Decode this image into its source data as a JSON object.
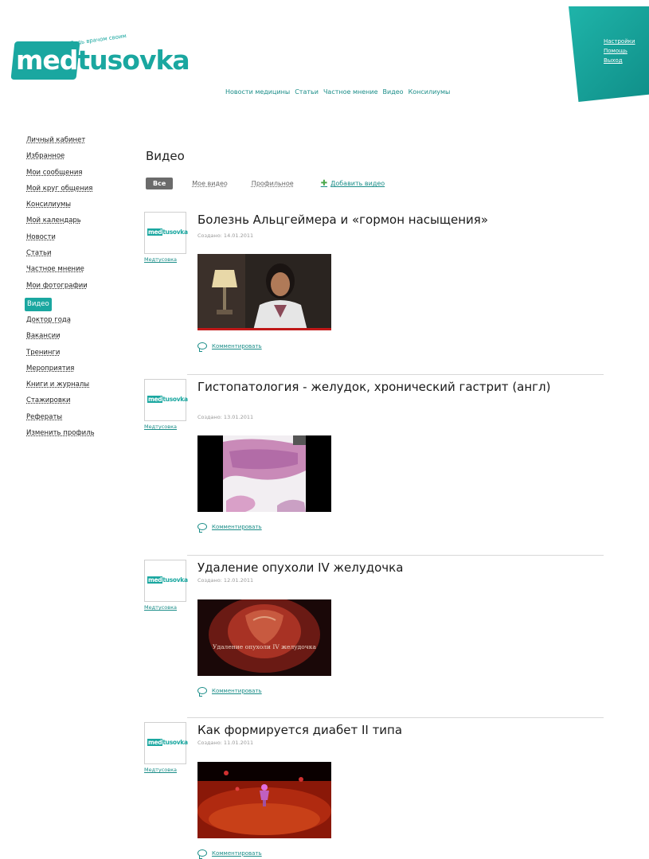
{
  "header": {
    "logo_prefix": "med",
    "logo_suffix": "tusovka",
    "tagline": "Будь врачом своим",
    "corner_links": [
      "Настройки",
      "Помощь",
      "Выход"
    ],
    "nav": [
      "Новости медицины",
      "Статьи",
      "Частное мнение",
      "Видео",
      "Консилиумы"
    ]
  },
  "sidebar": {
    "items": [
      "Личный кабинет",
      "Избранное",
      "Мои сообщения",
      "Мой круг общения",
      "Консилиумы",
      "Мой календарь",
      "Новости",
      "Статьи",
      "Частное мнение",
      "Мои фотографии",
      "Видео",
      "Доктор года",
      "Вакансии",
      "Тренинги",
      "Мероприятия",
      "Книги и журналы",
      "Стажировки",
      "Рефераты",
      "Изменить профиль"
    ],
    "active_index": 10
  },
  "main": {
    "title": "Видео",
    "filters": {
      "all": "Все",
      "mine": "Мое видео",
      "profile": "Профильное",
      "add": "Добавить видео"
    },
    "avatar_prefix": "med",
    "avatar_suffix": "tusovka",
    "comment_label": "Комментировать",
    "posts": [
      {
        "title": "Болезнь Альцгеймера и «гормон насыщения»",
        "date": "Создано: 14.01.2011",
        "author": "Медтусовка"
      },
      {
        "title": "Гистопатология - желудок, хронический гастрит (англ)",
        "date": "Создано: 13.01.2011",
        "author": "Медтусовка"
      },
      {
        "title": "Удаление опухоли IV желудочка",
        "date": "Создано: 12.01.2011",
        "author": "Медтусовка",
        "thumb_caption": "Удаление опухоли IV желудочка"
      },
      {
        "title": "Как формируется диабет II типа",
        "date": "Создано: 11.01.2011",
        "author": "Медтусовка"
      }
    ]
  },
  "colors": {
    "accent": "#1aa7a0",
    "accent_dark": "#1a8d88",
    "filter_active": "#6b6b6b"
  }
}
